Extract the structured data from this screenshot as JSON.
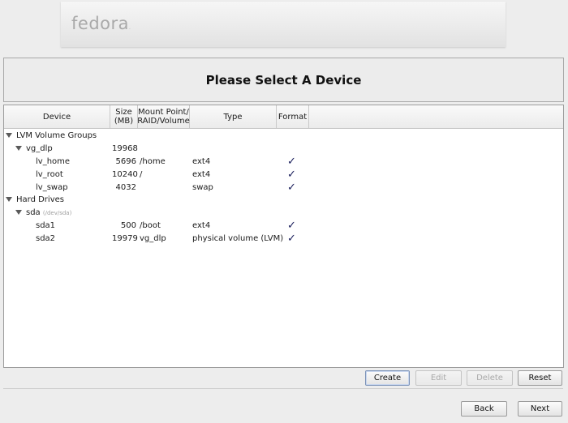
{
  "brand": {
    "logo_text": "fedora",
    "logo_mark": "."
  },
  "header": {
    "title": "Please Select A Device"
  },
  "columns": {
    "device": "Device",
    "size_1": "Size",
    "size_2": "(MB)",
    "mount_1": "Mount Point/",
    "mount_2": "RAID/Volume",
    "type": "Type",
    "format": "Format"
  },
  "tree": {
    "lvm_group": "LVM Volume Groups",
    "vg": {
      "name": "vg_dlp",
      "size": "19968"
    },
    "lvs": [
      {
        "name": "lv_home",
        "size": "5696",
        "mount": "/home",
        "type": "ext4",
        "format": true
      },
      {
        "name": "lv_root",
        "size": "10240",
        "mount": "/",
        "type": "ext4",
        "format": true
      },
      {
        "name": "lv_swap",
        "size": "4032",
        "mount": "",
        "type": "swap",
        "format": true
      }
    ],
    "hard_drives": "Hard Drives",
    "disk": {
      "name": "sda",
      "path": "(/dev/sda)"
    },
    "parts": [
      {
        "name": "sda1",
        "size": "500",
        "mount": "/boot",
        "type": "ext4",
        "format": true
      },
      {
        "name": "sda2",
        "size": "19979",
        "mount": "vg_dlp",
        "type": "physical volume (LVM)",
        "format": true
      }
    ],
    "check_glyph": "✓"
  },
  "actions": {
    "create": "Create",
    "edit": "Edit",
    "delete": "Delete",
    "reset": "Reset"
  },
  "nav": {
    "back": "Back",
    "next": "Next"
  }
}
